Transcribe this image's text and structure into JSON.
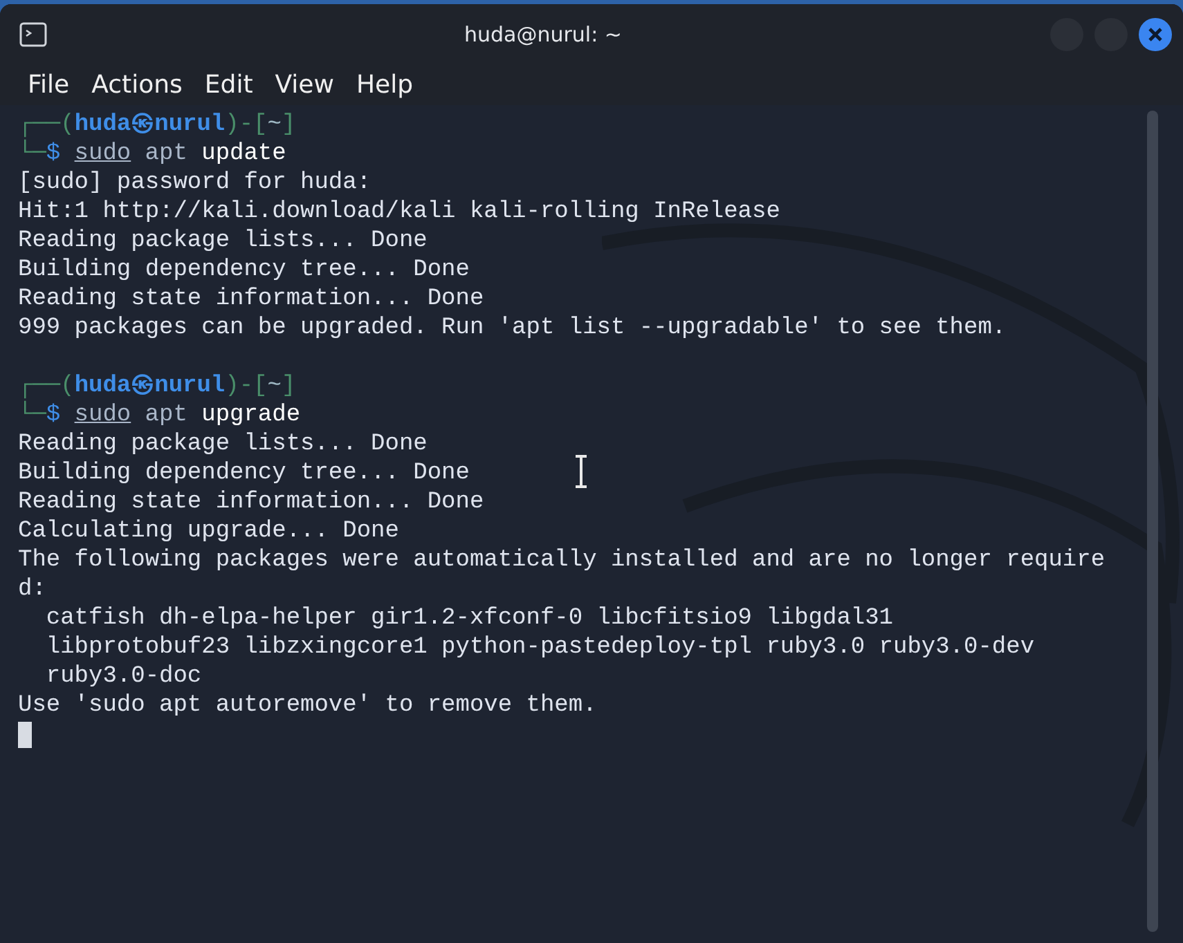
{
  "window": {
    "title": "huda@nurul: ~"
  },
  "menu": [
    "File",
    "Actions",
    "Edit",
    "View",
    "Help"
  ],
  "terminal": {
    "cursor": true,
    "lines": [
      {
        "kind": "prompt",
        "segments": [
          {
            "text": "┌──(",
            "kind": "frame"
          },
          {
            "text": "huda㉿nurul",
            "kind": "host"
          },
          {
            "text": ")-[",
            "kind": "frame"
          },
          {
            "text": "~",
            "kind": "dir"
          },
          {
            "text": "]",
            "kind": "frame"
          }
        ]
      },
      {
        "kind": "command",
        "segments": [
          {
            "text": "└─",
            "kind": "frame"
          },
          {
            "text": "$",
            "kind": "sign"
          },
          {
            "text": "sudo",
            "kind": "sudo"
          },
          {
            "text": " apt",
            "kind": "arg"
          },
          {
            "text": " update",
            "kind": "plain"
          }
        ]
      },
      {
        "kind": "output",
        "text": "[sudo] password for huda:"
      },
      {
        "kind": "output",
        "text": "Hit:1 http://kali.download/kali kali-rolling InRelease"
      },
      {
        "kind": "output",
        "text": "Reading package lists... Done"
      },
      {
        "kind": "output",
        "text": "Building dependency tree... Done"
      },
      {
        "kind": "output",
        "text": "Reading state information... Done"
      },
      {
        "kind": "output",
        "text": "999 packages can be upgraded. Run 'apt list --upgradable' to see them."
      },
      {
        "kind": "blank"
      },
      {
        "kind": "prompt",
        "segments": [
          {
            "text": "┌──(",
            "kind": "frame"
          },
          {
            "text": "huda㉿nurul",
            "kind": "host"
          },
          {
            "text": ")-[",
            "kind": "frame"
          },
          {
            "text": "~",
            "kind": "dir"
          },
          {
            "text": "]",
            "kind": "frame"
          }
        ]
      },
      {
        "kind": "command",
        "segments": [
          {
            "text": "└─",
            "kind": "frame"
          },
          {
            "text": "$",
            "kind": "sign"
          },
          {
            "text": "sudo",
            "kind": "sudo"
          },
          {
            "text": " apt",
            "kind": "arg"
          },
          {
            "text": " upgrade",
            "kind": "plain"
          }
        ]
      },
      {
        "kind": "output",
        "text": "Reading package lists... Done"
      },
      {
        "kind": "output",
        "text": "Building dependency tree... Done"
      },
      {
        "kind": "output",
        "text": "Reading state information... Done"
      },
      {
        "kind": "output",
        "text": "Calculating upgrade... Done"
      },
      {
        "kind": "output",
        "text": "The following packages were automatically installed and are no longer require"
      },
      {
        "kind": "output",
        "text": "d:"
      },
      {
        "kind": "output",
        "text": "  catfish dh-elpa-helper gir1.2-xfconf-0 libcfitsio9 libgdal31"
      },
      {
        "kind": "output",
        "text": "  libprotobuf23 libzxingcore1 python-pastedeploy-tpl ruby3.0 ruby3.0-dev"
      },
      {
        "kind": "output",
        "text": "  ruby3.0-doc"
      },
      {
        "kind": "output",
        "text": "Use 'sudo apt autoremove' to remove them."
      }
    ]
  }
}
